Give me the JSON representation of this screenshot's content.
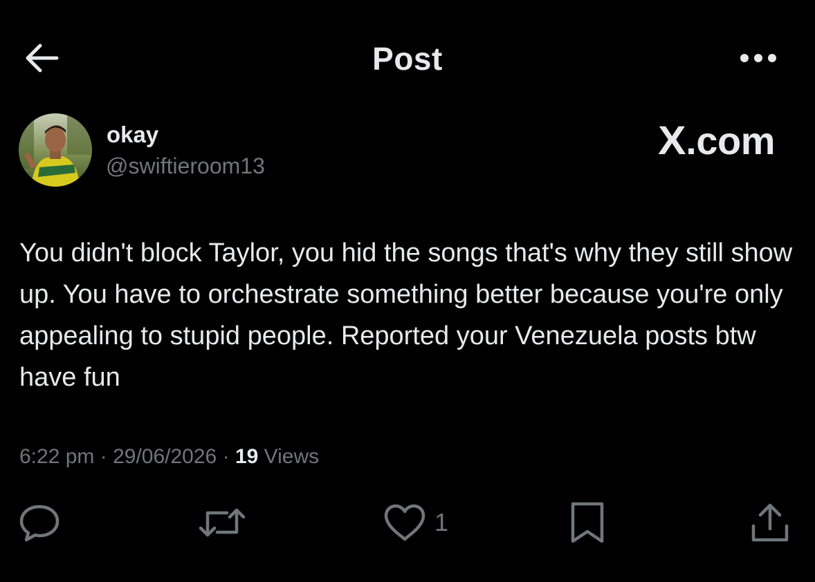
{
  "header": {
    "title": "Post",
    "back_icon": "arrow-left-icon",
    "more_icon": "more-horizontal-icon"
  },
  "author": {
    "display_name": "okay",
    "handle": "@swiftieroom13",
    "avatar_icon": "profile-photo"
  },
  "watermark": {
    "brand_letter": "X",
    "brand_suffix": ".com"
  },
  "post": {
    "text": "You didn't block Taylor, you hid the songs that's why they still show up. You have to orchestrate something better because you're only appealing to stupid people. Reported your Venezuela posts btw have fun"
  },
  "meta": {
    "time": "6:22 pm",
    "separator": "·",
    "date": "29/06/2026",
    "views_count": "19",
    "views_label": "Views"
  },
  "actions": {
    "reply_icon": "reply-icon",
    "repost_icon": "repost-icon",
    "like_icon": "heart-icon",
    "like_count": "1",
    "bookmark_icon": "bookmark-icon",
    "share_icon": "share-icon"
  },
  "colors": {
    "background": "#000000",
    "text_primary": "#e7e9ea",
    "text_secondary": "#71767b"
  }
}
